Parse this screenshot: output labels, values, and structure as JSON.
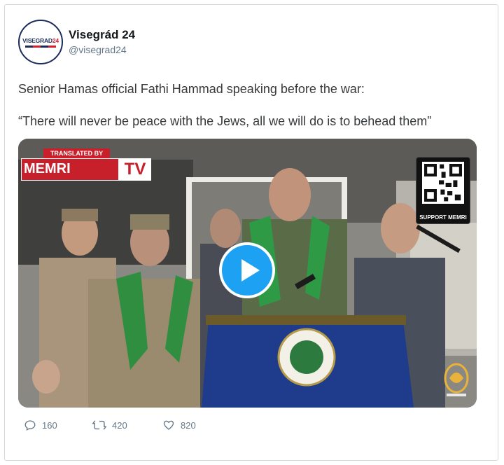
{
  "author": {
    "name": "Visegrád 24",
    "handle": "@visegrad24",
    "avatar_text": "VISEGRAD",
    "avatar_number": "24"
  },
  "tweet": {
    "line1": "Senior Hamas official Fathi Hammad speaking before the war:",
    "line2": "“There will never be peace with the Jews, all we will do is to behead them”"
  },
  "video": {
    "memri_top": "TRANSLATED BY",
    "memri_brand": "MEMRI",
    "memri_tv": "TV",
    "qr_label": "SUPPORT MEMRI"
  },
  "stats": {
    "replies": "160",
    "retweets": "420",
    "likes": "820"
  },
  "colors": {
    "accent": "#1da1f2",
    "muted": "#657786",
    "memri_red": "#c8202a"
  }
}
